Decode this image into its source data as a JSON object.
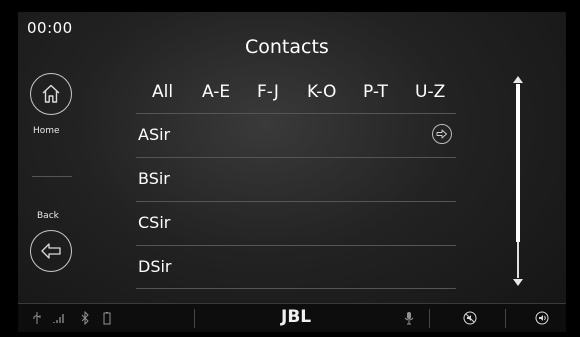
{
  "clock": "00:00",
  "title": "Contacts",
  "side": {
    "home_label": "Home",
    "back_label": "Back"
  },
  "tabs": [
    {
      "label": "All"
    },
    {
      "label": "A-E"
    },
    {
      "label": "F-J"
    },
    {
      "label": "K-O"
    },
    {
      "label": "P-T"
    },
    {
      "label": "U-Z"
    }
  ],
  "contacts": [
    {
      "name": "ASir"
    },
    {
      "name": "BSir"
    },
    {
      "name": "CSir"
    },
    {
      "name": "DSir"
    }
  ],
  "statusbar": {
    "brand": "JBL",
    "icons": [
      "usb-icon",
      "signal-icon",
      "bluetooth-icon",
      "battery-icon",
      "microphone-icon",
      "mute-icon",
      "volume-icon"
    ]
  },
  "colors": {
    "background": "#000000",
    "panel": "#222222",
    "text": "#ffffff",
    "divider": "#555555"
  }
}
